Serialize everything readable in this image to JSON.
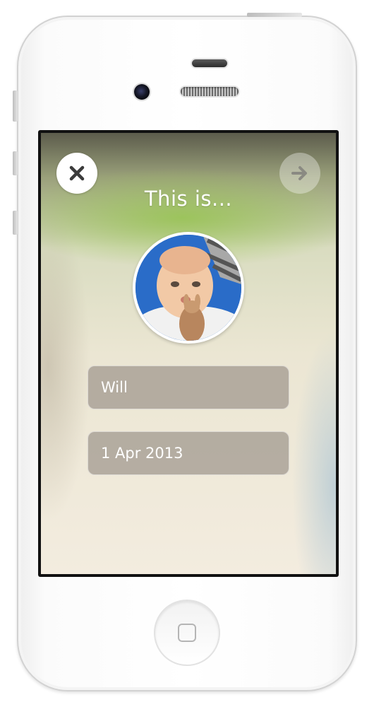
{
  "header": {
    "title": "This is..."
  },
  "buttons": {
    "close_icon": "close-icon",
    "next_icon": "arrow-right-icon"
  },
  "profile": {
    "photo": "baby-photo"
  },
  "form": {
    "name_value": "Will",
    "date_value": "1 Apr 2013"
  },
  "colors": {
    "accent_green": "#96c450",
    "field_background": "#9e968c",
    "background_cream": "#f3ecdf"
  }
}
